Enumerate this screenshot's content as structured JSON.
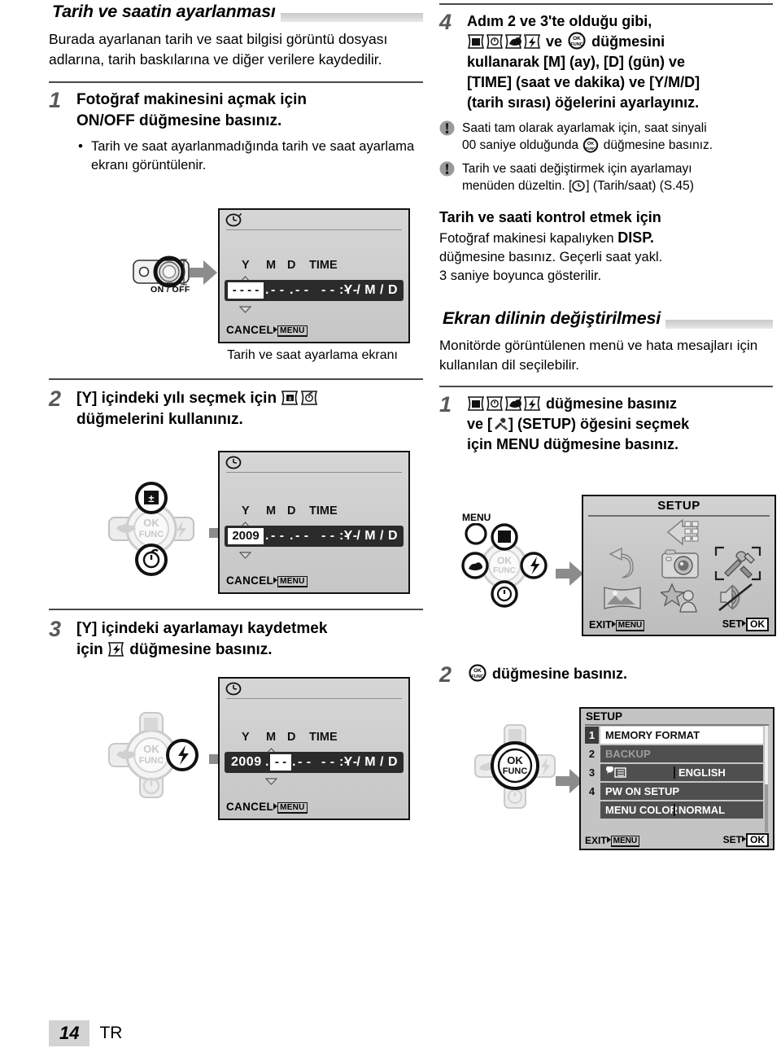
{
  "left": {
    "section_title": "Tarih ve saatin ayarlanması",
    "intro": "Burada ayarlanan tarih ve saat bilgisi görüntü dosyası adlarına, tarih baskılarına ve diğer verilere kaydedilir.",
    "step1": {
      "num": "1",
      "head_line1": "Fotoğraf makinesini açmak için",
      "head_line2": "ON/OFF düğmesine basınız.",
      "bullet": "Tarih ve saat ayarlanmadığında tarih ve saat ayarlama ekranı görüntülenir."
    },
    "onoff_label": "ON / OFF",
    "lcd1": {
      "headers": [
        "Y",
        "M",
        "D",
        "TIME"
      ],
      "year": "- - - -",
      "month": "- -",
      "day": "- -",
      "hour": "- -",
      "minute": "- -",
      "order": "Y / M / D",
      "cancel": "CANCEL",
      "menu": "MENU",
      "highlight": "year"
    },
    "lcd1_caption": "Tarih ve saat ayarlama ekranı",
    "step2": {
      "num": "2",
      "head_line1": "[Y] içindeki yılı seçmek için",
      "head_line2": "düğmelerini kullanınız."
    },
    "lcd2": {
      "headers": [
        "Y",
        "M",
        "D",
        "TIME"
      ],
      "year": "2009",
      "month": "- -",
      "day": "- -",
      "hour": "- -",
      "minute": "- -",
      "order": "Y / M / D",
      "cancel": "CANCEL",
      "menu": "MENU",
      "highlight": "year"
    },
    "step3": {
      "num": "3",
      "head_line1": "[Y] içindeki ayarlamayı kaydetmek",
      "head_line2_pre": "için",
      "head_line2_post": "düğmesine basınız."
    },
    "lcd3": {
      "headers": [
        "Y",
        "M",
        "D",
        "TIME"
      ],
      "year": "2009",
      "month": "- -",
      "day": "- -",
      "hour": "- -",
      "minute": "- -",
      "order": "Y / M / D",
      "cancel": "CANCEL",
      "menu": "MENU",
      "highlight": "month"
    }
  },
  "right": {
    "step4": {
      "num": "4",
      "line1": "Adım 2 ve 3'te olduğu gibi,",
      "line2_mid": "ve",
      "line2_end": "düğmesini",
      "line3": "kullanarak [M] (ay), [D] (gün) ve",
      "line4": "[TIME] (saat ve dakika) ve [Y/M/D]",
      "line5": "(tarih sırası) öğelerini ayarlayınız."
    },
    "note1_a": "Saati tam olarak ayarlamak için, saat sinyali",
    "note1_b_pre": "00 saniye olduğunda",
    "note1_b_post": "düğmesine basınız.",
    "note2_a": "Tarih ve saati değiştirmek için ayarlamayı",
    "note2_b_pre": "menüden düzeltin. [",
    "note2_b_post": "] (Tarih/saat) (S.45)",
    "check": {
      "head": "Tarih ve saati kontrol etmek için",
      "l1_pre": "Fotoğraf makinesi kapalıyken ",
      "l1_bold": "DISP.",
      "l2": "düğmesine basınız. Geçerli saat yakl.",
      "l3": "3 saniye boyunca gösterilir."
    },
    "section_title2": "Ekran dilinin değiştirilmesi",
    "intro2": "Monitörde görüntülenen menü ve hata mesajları için kullanılan dil seçilebilir.",
    "lang_step1": {
      "num": "1",
      "line1_end": "düğmesine basınız",
      "line2_pre": "ve [",
      "line2_post": "] (SETUP) öğesini seçmek",
      "line3": "için MENU düğmesine basınız."
    },
    "menu_label": "MENU",
    "setup_screen": {
      "title": "SETUP",
      "exit": "EXIT",
      "menu_tag": "MENU",
      "set": "SET",
      "ok_tag": "OK",
      "icons": [
        "silhouette-icon",
        "undo-arrow-icon",
        "camera-icon",
        "tools-setup-icon",
        "panorama-icon",
        "scene-person-icon",
        "silent-icon"
      ]
    },
    "lang_step2": {
      "num": "2",
      "text": "düğmesine basınız."
    },
    "setup_list": {
      "title": "SETUP",
      "rows": [
        {
          "index": "1",
          "label": "MEMORY FORMAT",
          "value": "",
          "selected": true
        },
        {
          "index": "2",
          "label": "BACKUP",
          "value": "",
          "dim": true
        },
        {
          "index": "3",
          "label": "",
          "icon": "language-icon",
          "value": "ENGLISH"
        },
        {
          "index": "4",
          "label": "PW ON SETUP",
          "value": ""
        },
        {
          "index": "",
          "label": "MENU COLOR",
          "value": "NORMAL"
        }
      ],
      "exit": "EXIT",
      "menu_tag": "MENU",
      "set": "SET",
      "ok_tag": "OK"
    }
  },
  "footer": {
    "page": "14",
    "lang": "TR"
  },
  "colors": {
    "rule": "#4a4a4a",
    "heading_bar": "#c9c9c9",
    "lcd_field": "#2b2b2b",
    "page_bg": "#d3d3d3"
  }
}
